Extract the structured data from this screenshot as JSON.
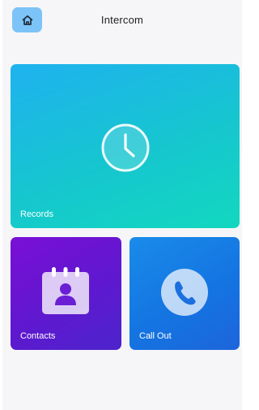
{
  "header": {
    "title": "Intercom",
    "home_icon": "home-icon"
  },
  "tiles": {
    "records": {
      "label": "Records",
      "icon": "clock-icon"
    },
    "contacts": {
      "label": "Contacts",
      "icon": "contact-book-icon"
    },
    "call_out": {
      "label": "Call Out",
      "icon": "phone-icon"
    }
  },
  "colors": {
    "home_button": "#7cc3f7",
    "records_gradient": [
      "#1fb2ef",
      "#12d8bf"
    ],
    "contacts_gradient": [
      "#7a0fd6",
      "#4c24cc"
    ],
    "call_out_gradient": [
      "#1a8bea",
      "#1d65db"
    ],
    "background": "#f6f6f8"
  }
}
